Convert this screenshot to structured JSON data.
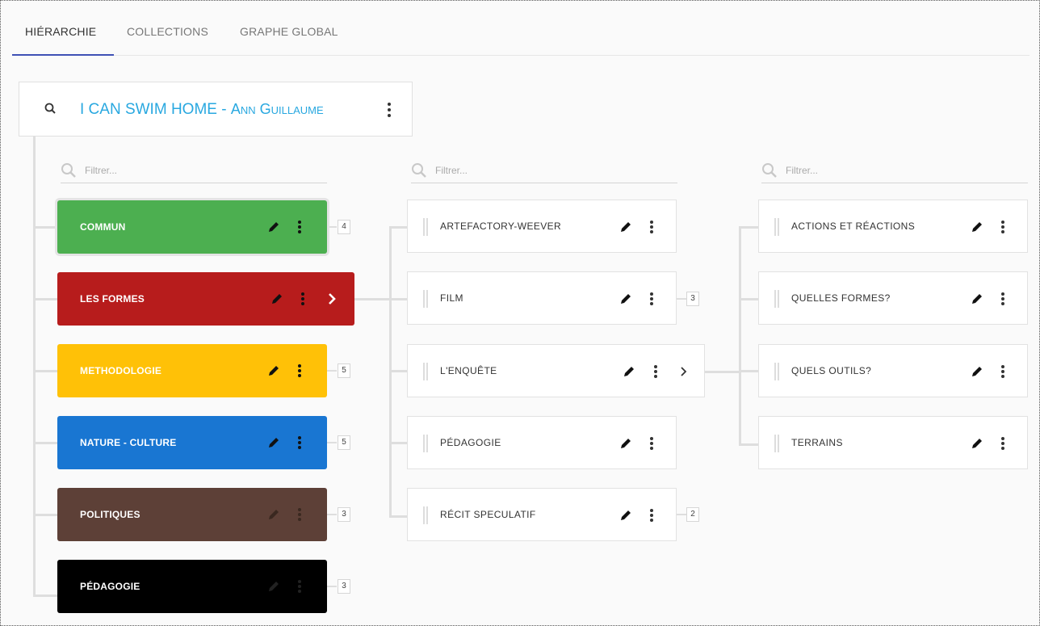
{
  "tabs": [
    {
      "label": "HIÉRARCHIE",
      "active": true
    },
    {
      "label": "COLLECTIONS",
      "active": false
    },
    {
      "label": "GRAPHE GLOBAL",
      "active": false
    }
  ],
  "root": {
    "title_main": "I CAN SWIM HOME - ",
    "title_author": "Ann Guillaume"
  },
  "filter_placeholder": "Filtrer...",
  "column1": [
    {
      "label": "COMMUN",
      "color": "#4caf50",
      "count": "4"
    },
    {
      "label": "LES FORMES",
      "color": "#b71c1c",
      "count": ""
    },
    {
      "label": "METHODOLOGIE",
      "color": "#ffc107",
      "count": "5"
    },
    {
      "label": "NATURE - CULTURE",
      "color": "#1976d2",
      "count": "5"
    },
    {
      "label": "POLITIQUES",
      "color": "#5d4037",
      "count": "3"
    },
    {
      "label": "PÉDAGOGIE",
      "color": "#000000",
      "count": "3"
    }
  ],
  "column2": [
    {
      "label": "ARTEFACTORY-WEEVER",
      "count": ""
    },
    {
      "label": "FILM",
      "count": "3"
    },
    {
      "label": "L'ENQUÊTE",
      "count": ""
    },
    {
      "label": "PÉDAGOGIE",
      "count": ""
    },
    {
      "label": "RÉCIT SPECULATIF",
      "count": "2"
    }
  ],
  "column3": [
    {
      "label": "ACTIONS ET RÉACTIONS"
    },
    {
      "label": "QUELLES FORMES?"
    },
    {
      "label": "QUELS OUTILS?"
    },
    {
      "label": "TERRAINS"
    }
  ]
}
